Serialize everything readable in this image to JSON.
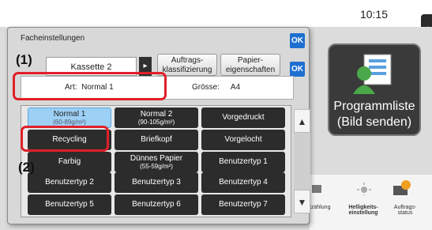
{
  "status": {
    "time": "10:15",
    "side_tab_glyph": "◂"
  },
  "dialog": {
    "title": "Facheinstellungen",
    "ok_label": "OK",
    "tabs": {
      "cassette": "Kassette 2",
      "arrow": "▸",
      "classification_line1": "Auftrags-",
      "classification_line2": "klassifizierung",
      "properties_line1": "Papier-",
      "properties_line2": "eigenschaften"
    },
    "info": {
      "type_label": "Art:",
      "type_value": "Normal 1",
      "size_label": "Grösse:",
      "size_value": "A4"
    },
    "paper_types": [
      {
        "label": "Normal 1",
        "sub": "(60-89g/m²)",
        "selected": true
      },
      {
        "label": "Normal 2",
        "sub": "(90-105g/m²)",
        "selected": false
      },
      {
        "label": "Vorgedruckt",
        "sub": "",
        "selected": false
      },
      {
        "label": "Recycling",
        "sub": "",
        "selected": false
      },
      {
        "label": "Briefkopf",
        "sub": "",
        "selected": false
      },
      {
        "label": "Vorgelocht",
        "sub": "",
        "selected": false
      },
      {
        "label": "Farbig",
        "sub": "",
        "selected": false
      },
      {
        "label": "Dünnes Papier",
        "sub": "(55-59g/m²)",
        "selected": false
      },
      {
        "label": "Benutzertyp 1",
        "sub": "",
        "selected": false
      },
      {
        "label": "Benutzertyp 2",
        "sub": "",
        "selected": false
      },
      {
        "label": "Benutzertyp 3",
        "sub": "",
        "selected": false
      },
      {
        "label": "Benutzertyp 4",
        "sub": "",
        "selected": false
      },
      {
        "label": "Benutzertyp 5",
        "sub": "",
        "selected": false
      },
      {
        "label": "Benutzertyp 6",
        "sub": "",
        "selected": false
      },
      {
        "label": "Benutzertyp 7",
        "sub": "",
        "selected": false
      }
    ],
    "scroll_up": "▲",
    "scroll_down": "▼"
  },
  "background": {
    "program_list_line1": "Programmliste",
    "program_list_line2": "(Bild senden)",
    "bottom_items": [
      {
        "label": "tzählung"
      },
      {
        "label_line1": "Helligkeits-",
        "label_line2": "einstellung"
      },
      {
        "label_line1": "Auftrags-",
        "label_line2": "status"
      }
    ]
  },
  "annotations": {
    "callout_1": "(1)",
    "callout_2": "(2)"
  },
  "colors": {
    "accent": "#1f6fd1",
    "highlight": "#e0202a",
    "selected": "#9dd0f5",
    "button": "#2c2c2c"
  }
}
